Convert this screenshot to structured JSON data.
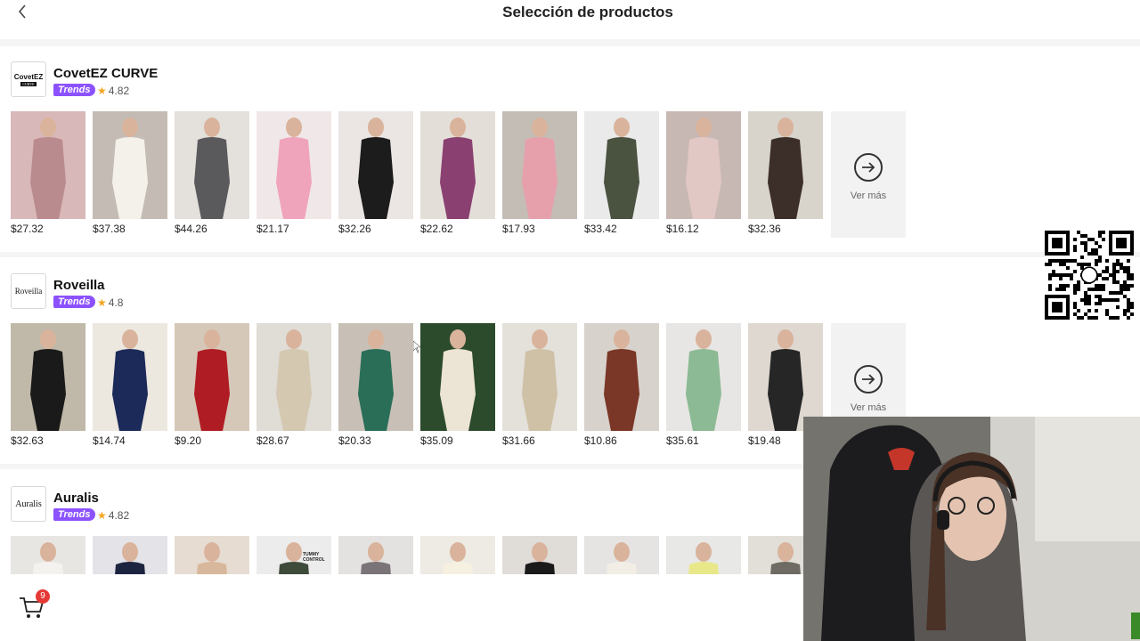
{
  "header": {
    "title": "Selección de productos"
  },
  "stores": [
    {
      "name": "CovetEZ CURVE",
      "logo_text": "CovetEZ",
      "logo_sub": "CURVE",
      "badge": "Trends",
      "rating": "4.82",
      "products": [
        {
          "price": "$27.32",
          "colors": [
            "#d8b8b8",
            "#b98a8e"
          ]
        },
        {
          "price": "$37.38",
          "colors": [
            "#c4bcb4",
            "#f4f0ea"
          ]
        },
        {
          "price": "$44.26",
          "colors": [
            "#e4e0dc",
            "#5a5a5c"
          ]
        },
        {
          "price": "$21.17",
          "colors": [
            "#f0e8e8",
            "#f0a4bc"
          ]
        },
        {
          "price": "$32.26",
          "colors": [
            "#ebe6e3",
            "#1c1c1c"
          ]
        },
        {
          "price": "$22.62",
          "colors": [
            "#e4ded8",
            "#8a4070"
          ]
        },
        {
          "price": "$17.93",
          "colors": [
            "#c4bdb6",
            "#e6a0ac"
          ]
        },
        {
          "price": "$33.42",
          "colors": [
            "#eaeaea",
            "#4a5240"
          ]
        },
        {
          "price": "$16.12",
          "colors": [
            "#c8b8b4",
            "#e2c8c4"
          ]
        },
        {
          "price": "$32.36",
          "colors": [
            "#d8d4cc",
            "#3c2e28"
          ]
        }
      ],
      "more_label": "Ver más"
    },
    {
      "name": "Roveilla",
      "logo_text": "Roveilla",
      "logo_sub": "",
      "badge": "Trends",
      "rating": "4.8",
      "products": [
        {
          "price": "$32.63",
          "colors": [
            "#c0b8a8",
            "#1a1a1a"
          ]
        },
        {
          "price": "$14.74",
          "colors": [
            "#ece8e0",
            "#1c2a5a"
          ]
        },
        {
          "price": "$9.20",
          "colors": [
            "#d6c8b8",
            "#b01c24"
          ]
        },
        {
          "price": "$28.67",
          "colors": [
            "#e0dcd6",
            "#d4c8b0"
          ]
        },
        {
          "price": "$20.33",
          "colors": [
            "#c8c0b6",
            "#2a6e58"
          ]
        },
        {
          "price": "$35.09",
          "colors": [
            "#2c4a2c",
            "#ece4d4"
          ]
        },
        {
          "price": "$31.66",
          "colors": [
            "#e4e0da",
            "#cfc1a6"
          ]
        },
        {
          "price": "$10.86",
          "colors": [
            "#d8d2cc",
            "#7a3626"
          ]
        },
        {
          "price": "$35.61",
          "colors": [
            "#e8e6e4",
            "#8cba94"
          ]
        },
        {
          "price": "$19.48",
          "colors": [
            "#ded8d0",
            "#262626"
          ]
        }
      ],
      "more_label": "Ver más"
    },
    {
      "name": "Auralis",
      "logo_text": "Auralis",
      "logo_sub": "",
      "badge": "Trends",
      "rating": "4.82",
      "products": [
        {
          "price": "",
          "colors": [
            "#e8e6e2",
            "#f4f2ee"
          ]
        },
        {
          "price": "",
          "colors": [
            "#e4e4e8",
            "#1c2440"
          ]
        },
        {
          "price": "",
          "colors": [
            "#e6dcd2",
            "#d8b89c"
          ]
        },
        {
          "price": "",
          "colors": [
            "#ececec",
            "#3e4a3a"
          ],
          "label": "TUMMY CONTROL"
        },
        {
          "price": "",
          "colors": [
            "#e4e2e0",
            "#7a7478"
          ]
        },
        {
          "price": "",
          "colors": [
            "#eeeae4",
            "#f6f0e0"
          ]
        },
        {
          "price": "",
          "colors": [
            "#e0dcd8",
            "#1a1a1a"
          ]
        },
        {
          "price": "",
          "colors": [
            "#e6e4e2",
            "#f2eee6"
          ]
        },
        {
          "price": "",
          "colors": [
            "#e8e8e6",
            "#e8e88a"
          ]
        },
        {
          "price": "",
          "colors": [
            "#e2ded8",
            "#6e6a64"
          ]
        }
      ]
    }
  ],
  "cart": {
    "count": "9"
  }
}
